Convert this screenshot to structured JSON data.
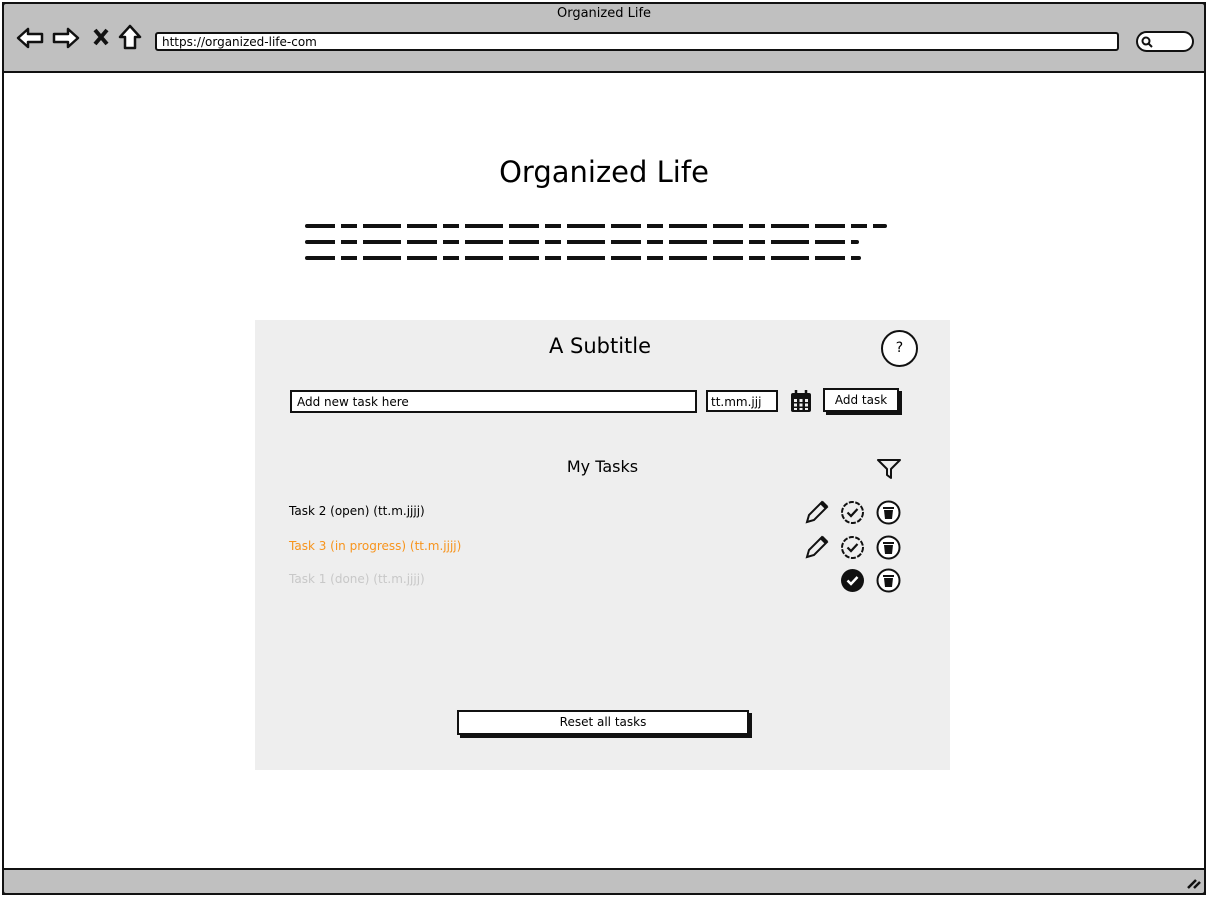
{
  "window": {
    "title": "Organized Life",
    "url": "https://organized-life-com"
  },
  "page": {
    "title": "Organized Life"
  },
  "panel": {
    "subtitle": "A Subtitle",
    "help_label": "?",
    "task_placeholder": "Add new task here",
    "date_placeholder": "tt.mm.jjj",
    "add_label": "Add task",
    "list_title": "My Tasks",
    "reset_label": "Reset all tasks"
  },
  "tasks": [
    {
      "label": "Task 2 (open) (tt.m.jjjj)",
      "status": "open",
      "color": "#000000"
    },
    {
      "label": "Task 3 (in progress) (tt.m.jjjj)",
      "status": "in-progress",
      "color": "#f7941d"
    },
    {
      "label": "Task 1 (done) (tt.m.jjjj)",
      "status": "done",
      "color": "#c8c8c8"
    }
  ]
}
